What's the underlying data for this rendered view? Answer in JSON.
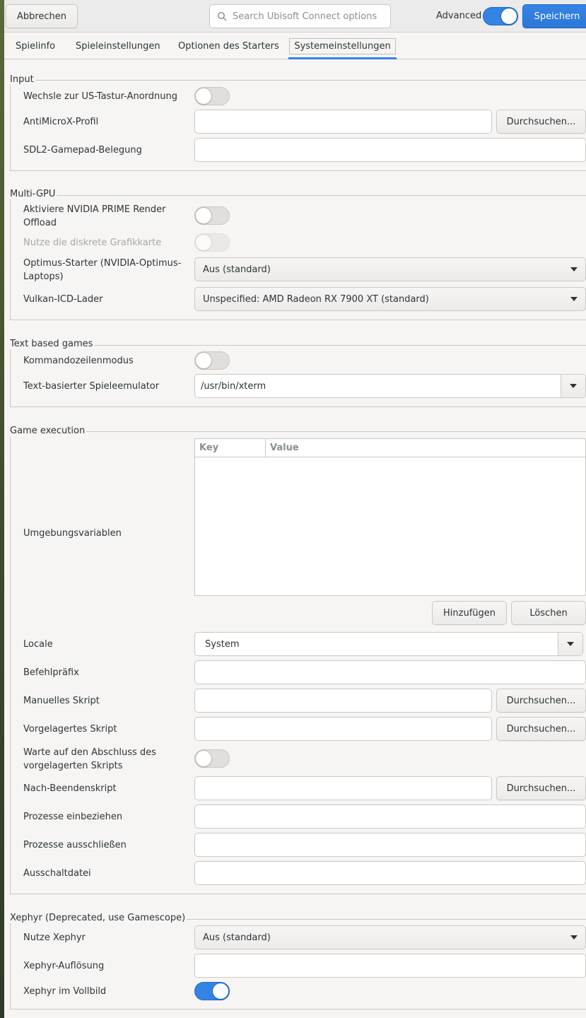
{
  "header": {
    "cancel_label": "Abbrechen",
    "search_placeholder": "Search Ubisoft Connect options",
    "advanced_label": "Advanced",
    "advanced_on": true,
    "save_label": "Speichern"
  },
  "tabs": [
    {
      "label": "Spielinfo"
    },
    {
      "label": "Spieleinstellungen"
    },
    {
      "label": "Optionen des Starters"
    },
    {
      "label": "Systemeinstellungen",
      "active": true
    }
  ],
  "sections": {
    "input": {
      "title": "Input",
      "us_layout_label": "Wechsle zur US-Tastur-Anordnung",
      "antimicrox_label": "AntiMicroX-Profil",
      "antimicrox_value": "",
      "browse_label": "Durchsuchen...",
      "sdl2_label": "SDL2-Gamepad-Belegung",
      "sdl2_value": ""
    },
    "multigpu": {
      "title": "Multi-GPU",
      "prime_label": "Aktiviere NVIDIA PRIME Render Offload",
      "discrete_label": "Nutze die diskrete Grafikkarte",
      "optimus_label": "Optimus-Starter (NVIDIA-Optimus-Laptops)",
      "optimus_value": "Aus (standard)",
      "vulkan_label": "Vulkan-ICD-Lader",
      "vulkan_value": "Unspecified: AMD Radeon RX 7900 XT (standard)"
    },
    "text_games": {
      "title": "Text based games",
      "cli_label": "Kommandozeilenmodus",
      "emulator_label": "Text-basierter Spieleemulator",
      "emulator_value": "/usr/bin/xterm"
    },
    "execution": {
      "title": "Game execution",
      "env_label": "Umgebungsvariablen",
      "col_key": "Key",
      "col_value": "Value",
      "add_label": "Hinzufügen",
      "delete_label": "Löschen",
      "locale_label": "Locale",
      "locale_value": "System",
      "prefix_label": "Befehlpräfix",
      "manual_script_label": "Manuelles Skript",
      "pre_script_label": "Vorgelagertes Skript",
      "wait_pre_label": "Warte auf den Abschluss des vorgelagerten Skripts",
      "post_script_label": "Nach-Beendenskript",
      "include_label": "Prozesse einbeziehen",
      "exclude_label": "Prozesse ausschließen",
      "kill_file_label": "Ausschaltdatei",
      "browse_label": "Durchsuchen..."
    },
    "xephyr": {
      "title": "Xephyr (Deprecated, use Gamescope)",
      "use_label": "Nutze Xephyr",
      "use_value": "Aus (standard)",
      "resolution_label": "Xephyr-Auflösung",
      "fullscreen_label": "Xephyr im Vollbild",
      "fullscreen_on": true
    }
  }
}
